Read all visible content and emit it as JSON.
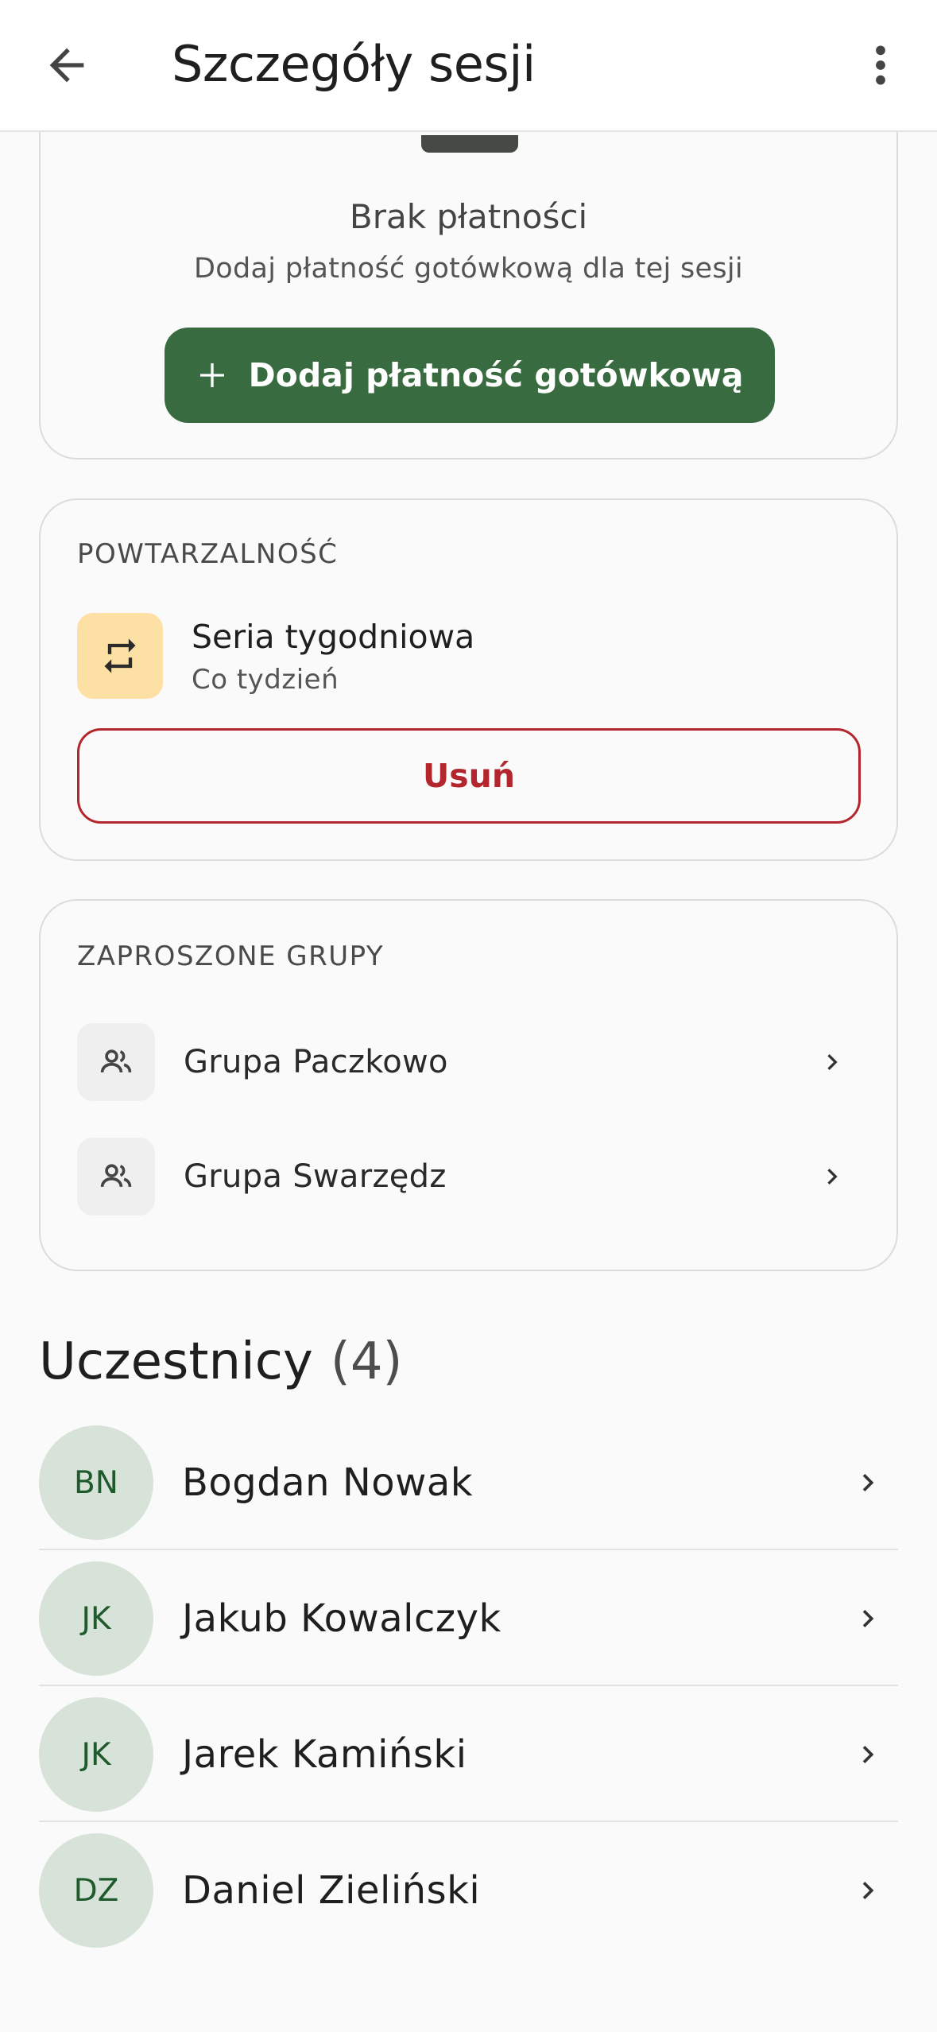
{
  "appbar": {
    "title": "Szczegóły sesji",
    "back_icon": "arrow-left-icon",
    "menu_icon": "more-vertical-icon"
  },
  "payment": {
    "empty_title": "Brak płatności",
    "empty_subtitle": "Dodaj płatność gotówkową dla tej sesji",
    "add_button_label": "Dodaj płatność gotówkową",
    "button_color": "#386b3f"
  },
  "recurrence": {
    "section_label": "POWTARZALNOŚĆ",
    "title": "Seria tygodniowa",
    "subtitle": "Co tydzień",
    "icon": "repeat-icon",
    "icon_bg": "#fde0a3",
    "remove_label": "Usuń",
    "remove_color": "#b3262d"
  },
  "groups": {
    "section_label": "ZAPROSZONE GRUPY",
    "items": [
      {
        "label": "Grupa Paczkowo"
      },
      {
        "label": "Grupa Swarzędz"
      }
    ]
  },
  "participants": {
    "title": "Uczestnicy",
    "count": "(4)",
    "items": [
      {
        "initials": "BN",
        "name": "Bogdan Nowak"
      },
      {
        "initials": "JK",
        "name": "Jakub Kowalczyk"
      },
      {
        "initials": "JK",
        "name": "Jarek Kamiński"
      },
      {
        "initials": "DZ",
        "name": "Daniel Zieliński"
      }
    ]
  }
}
